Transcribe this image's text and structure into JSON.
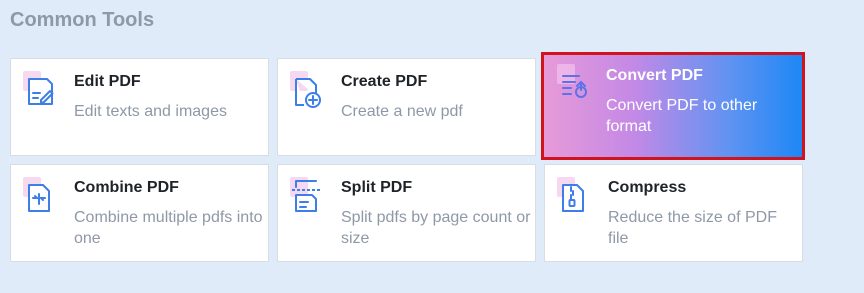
{
  "section": {
    "title": "Common Tools"
  },
  "tools": [
    {
      "title": "Edit PDF",
      "desc": "Edit texts and images",
      "icon": "edit-pdf-icon"
    },
    {
      "title": "Create PDF",
      "desc": "Create a new pdf",
      "icon": "create-pdf-icon"
    },
    {
      "title": "Convert PDF",
      "desc": "Convert PDF to other format",
      "icon": "convert-pdf-icon",
      "selected": true
    },
    {
      "title": "Combine PDF",
      "desc": "Combine multiple pdfs into one",
      "icon": "combine-pdf-icon"
    },
    {
      "title": "Split PDF",
      "desc": "Split pdfs by page count or size",
      "icon": "split-pdf-icon"
    },
    {
      "title": "Compress",
      "desc": "Reduce the size of PDF file",
      "icon": "compress-icon"
    }
  ],
  "colors": {
    "icon_blue": "#3d7ee8",
    "icon_pink": "#f6d9f1",
    "selected_border": "#d0131c",
    "background": "#dfebf9"
  }
}
